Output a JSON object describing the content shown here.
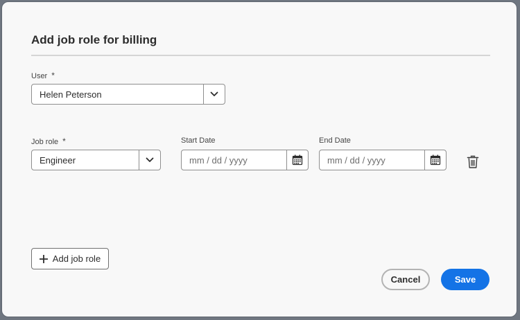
{
  "dialog": {
    "title": "Add job role for billing"
  },
  "user_field": {
    "label": "User",
    "required_mark": "*",
    "value": "Helen Peterson"
  },
  "job_role_field": {
    "label": "Job role",
    "required_mark": "*",
    "value": "Engineer"
  },
  "start_date_field": {
    "label": "Start Date",
    "placeholder": "mm / dd / yyyy"
  },
  "end_date_field": {
    "label": "End Date",
    "placeholder": "mm / dd / yyyy"
  },
  "actions": {
    "add_job_role": "Add job role",
    "cancel": "Cancel",
    "save": "Save"
  },
  "icons": {
    "user_dropdown": "chevron-down-icon",
    "role_dropdown": "chevron-down-icon",
    "start_calendar": "calendar-icon",
    "end_calendar": "calendar-icon",
    "delete": "trash-icon",
    "add": "plus-icon"
  },
  "colors": {
    "primary": "#1473e6",
    "background": "#f8f8f8"
  }
}
